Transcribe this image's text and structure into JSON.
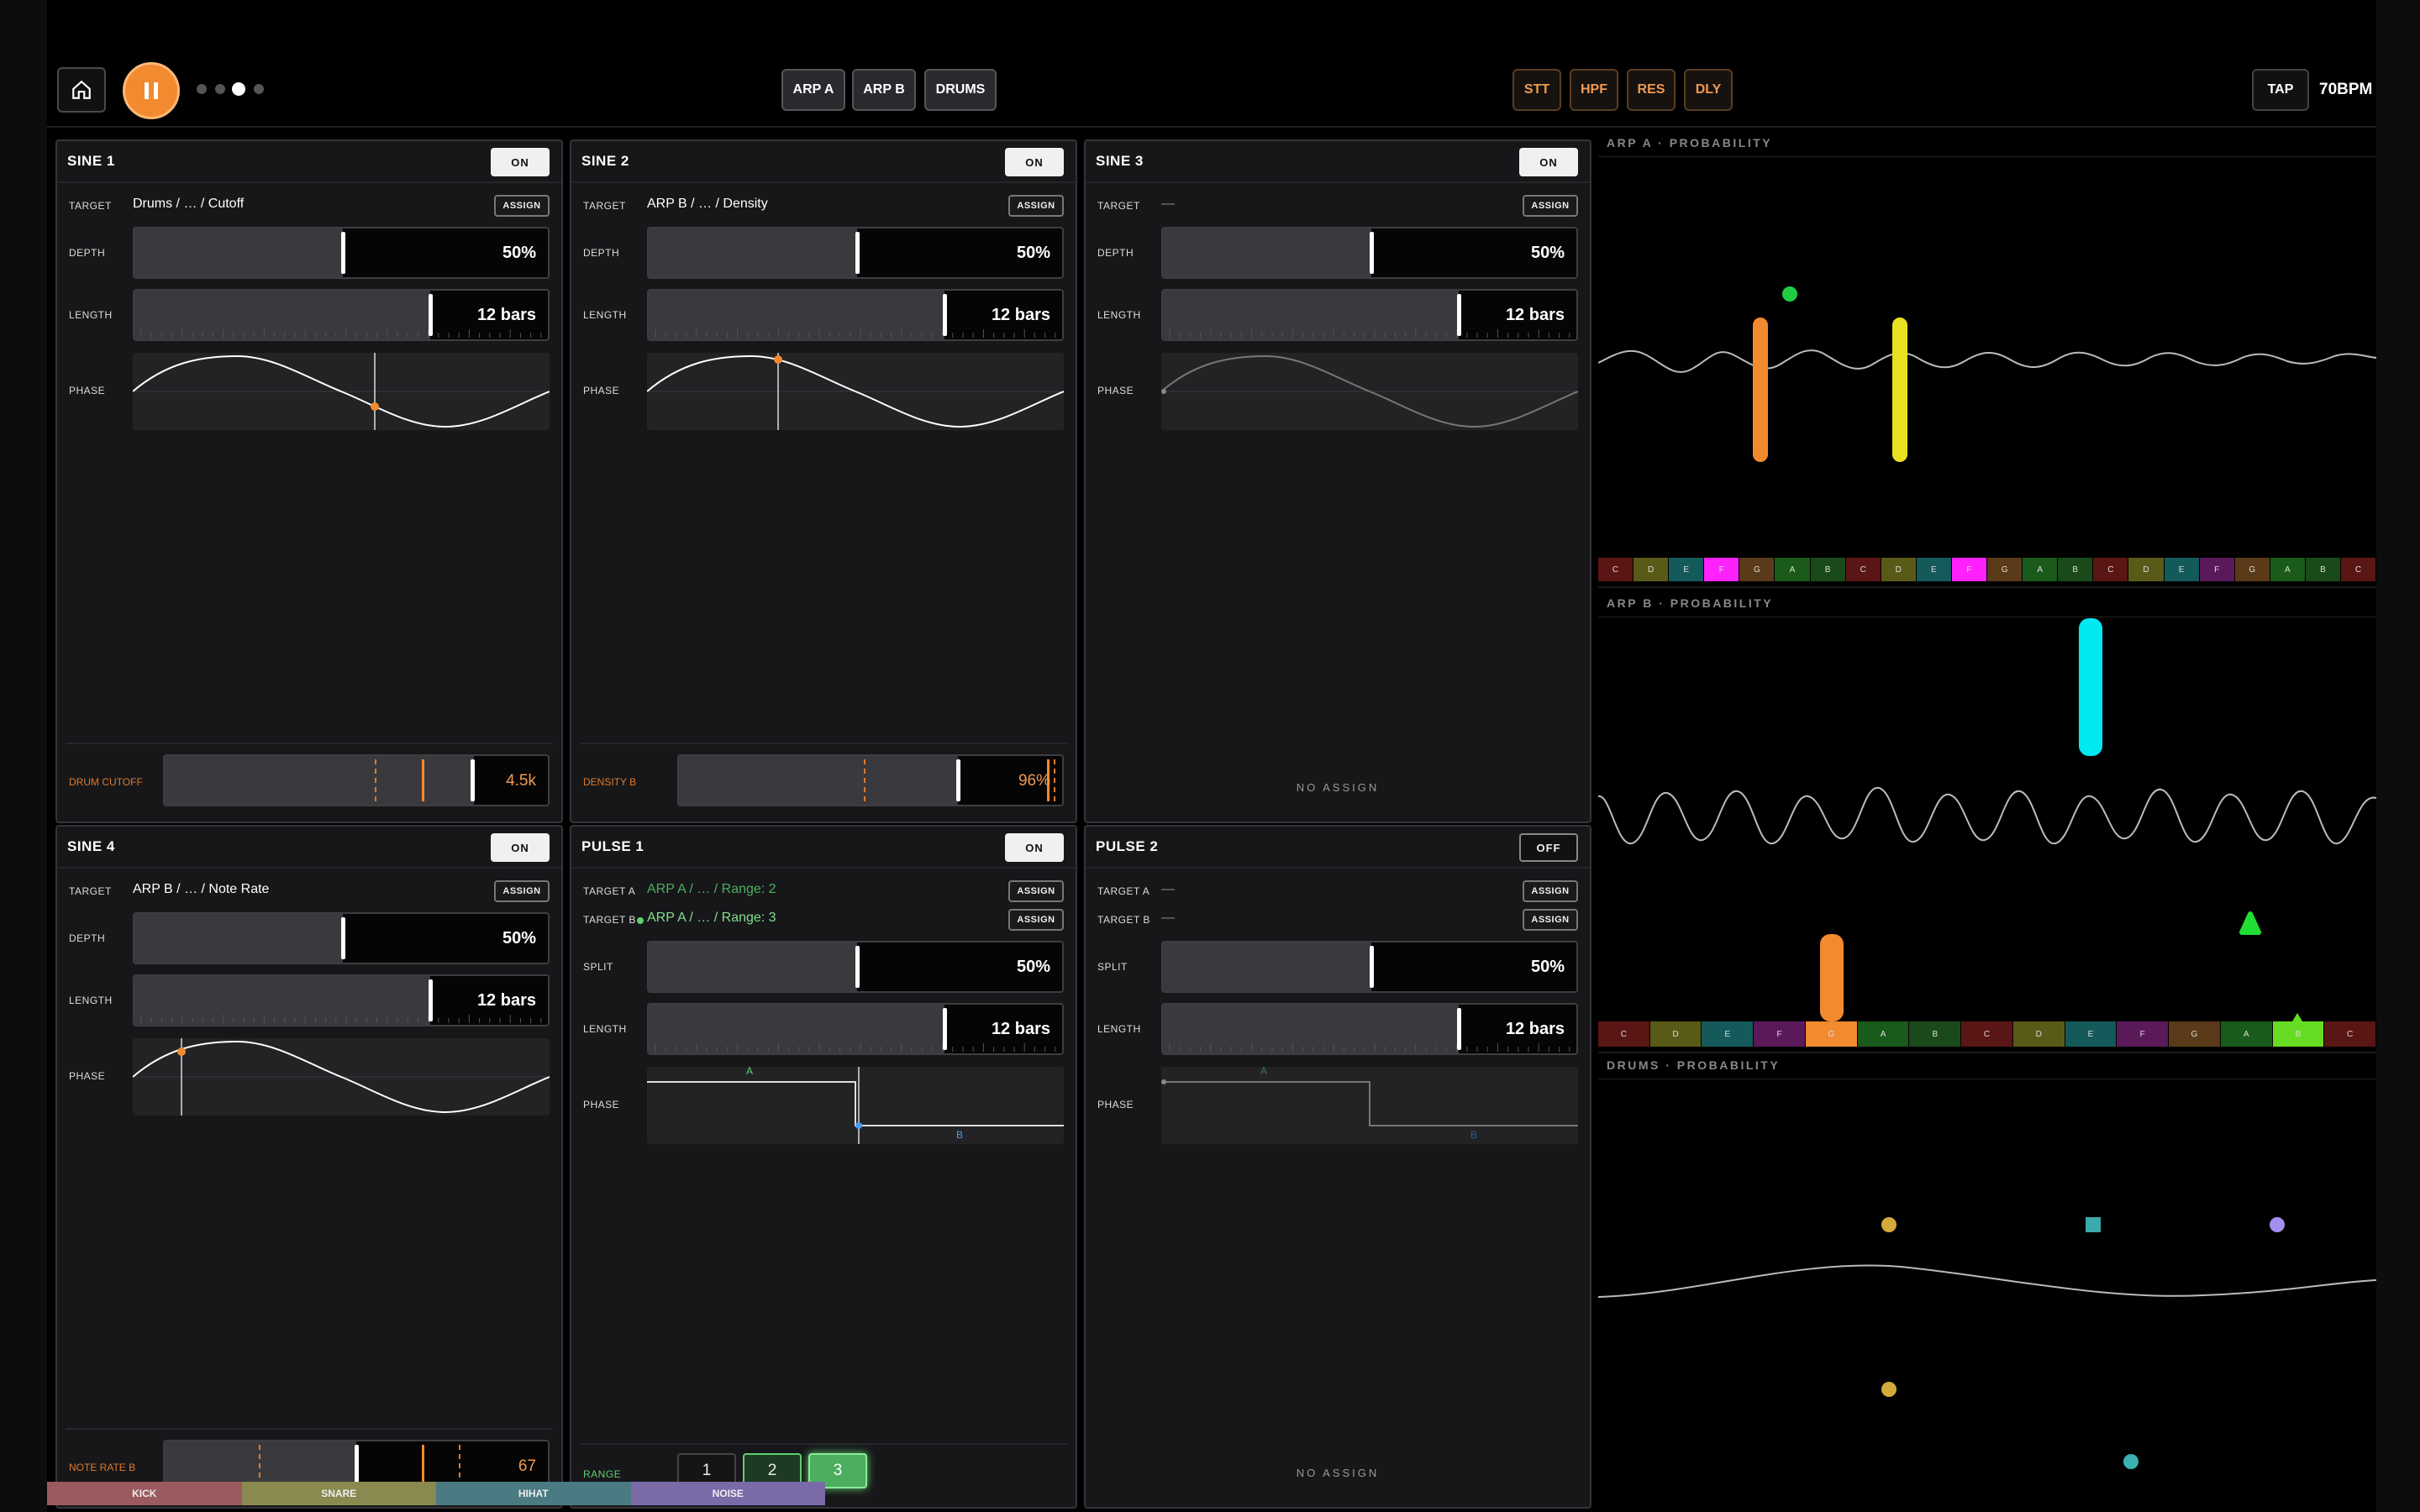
{
  "header": {
    "home_icon": "home-icon",
    "play_pause_icon": "pause-icon",
    "tracks": [
      "ARP A",
      "ARP B",
      "DRUMS"
    ],
    "fx": [
      "STT",
      "HPF",
      "RES",
      "DLY"
    ],
    "tap_label": "TAP",
    "bpm": "70BPM",
    "page_dots": 4,
    "active_dot": 3
  },
  "colors": {
    "accent": "#f28a30",
    "green": "#5fcf6e",
    "bg": "#000000",
    "panel": "#17171a"
  },
  "panels": [
    {
      "title": "SINE 1",
      "toggle": "ON",
      "target_label": "TARGET",
      "target": "Drums / … / Cutoff",
      "assign": "ASSIGN",
      "depth_label": "DEPTH",
      "depth_value": "50%",
      "depth": 0.5,
      "length_label": "LENGTH",
      "length_value": "12 bars",
      "length": 0.71,
      "phase_label": "PHASE",
      "phase": 0.58,
      "bottom_label": "DRUM CUTOFF",
      "bottom_value": "4.5k"
    },
    {
      "title": "SINE 2",
      "toggle": "ON",
      "target_label": "TARGET",
      "target": "ARP B / … / Density",
      "assign": "ASSIGN",
      "depth_label": "DEPTH",
      "depth_value": "50%",
      "depth": 0.5,
      "length_label": "LENGTH",
      "length_value": "12 bars",
      "length": 0.71,
      "phase_label": "PHASE",
      "phase": 0.31,
      "bottom_label": "DENSITY B",
      "bottom_value": "96%"
    },
    {
      "title": "SINE 3",
      "toggle": "ON",
      "target_label": "TARGET",
      "target": "—",
      "assign": "ASSIGN",
      "depth_label": "DEPTH",
      "depth_value": "50%",
      "depth": 0.5,
      "length_label": "LENGTH",
      "length_value": "12 bars",
      "length": 0.71,
      "phase_label": "PHASE",
      "phase": 0.0,
      "no_assign": "NO ASSIGN"
    },
    {
      "title": "SINE 4",
      "toggle": "ON",
      "target_label": "TARGET",
      "target": "ARP B / … / Note Rate",
      "assign": "ASSIGN",
      "depth_label": "DEPTH",
      "depth_value": "50%",
      "depth": 0.5,
      "length_label": "LENGTH",
      "length_value": "12 bars",
      "length": 0.71,
      "phase_label": "PHASE",
      "phase": 0.12,
      "bottom_label": "NOTE RATE B",
      "bottom_value": "67"
    },
    {
      "title": "PULSE 1",
      "toggle": "ON",
      "target_a_label": "TARGET A",
      "target_a": "ARP A / … / Range: 2",
      "target_b_label": "TARGET B",
      "target_b": "ARP A / … / Range: 3",
      "assign": "ASSIGN",
      "split_label": "SPLIT",
      "split_value": "50%",
      "split": 0.5,
      "length_label": "LENGTH",
      "length_value": "12 bars",
      "length": 0.71,
      "phase_label": "PHASE",
      "phase_a": "A",
      "phase_b": "B",
      "range_label": "RANGE",
      "range_options": [
        "1",
        "2",
        "3"
      ],
      "range_selected": "3"
    },
    {
      "title": "PULSE 2",
      "toggle": "OFF",
      "target_a_label": "TARGET A",
      "target_a": "—",
      "target_b_label": "TARGET B",
      "target_b": "—",
      "assign": "ASSIGN",
      "split_label": "SPLIT",
      "split_value": "50%",
      "split": 0.5,
      "length_label": "LENGTH",
      "length_value": "12 bars",
      "length": 0.71,
      "phase_label": "PHASE",
      "phase_a": "A",
      "phase_b": "B",
      "no_assign": "NO ASSIGN"
    }
  ],
  "viz": {
    "arp_a": {
      "title": "ARP A · PROBABILITY",
      "notes": [
        "C",
        "D",
        "E",
        "F",
        "G",
        "A",
        "B",
        "C",
        "D",
        "E",
        "F",
        "G",
        "A",
        "B",
        "C",
        "D",
        "E",
        "F",
        "G",
        "A",
        "B",
        "C"
      ],
      "note_colors": [
        "#5a1515",
        "#5a5a18",
        "#155a5a",
        "#ff22ff",
        "#5a3a18",
        "#1a5a1a",
        "#1a4a1a",
        "#5a1515",
        "#5a5a18",
        "#155a5a",
        "#ff22ff",
        "#5a3a18",
        "#1a5a1a",
        "#1a4a1a",
        "#5a1515",
        "#5a5a18",
        "#155a5a",
        "#5a1a5a",
        "#5a3a18",
        "#1a5a1a",
        "#1a4a1a",
        "#5a1515"
      ]
    },
    "arp_b": {
      "title": "ARP B · PROBABILITY",
      "notes": [
        "C",
        "D",
        "E",
        "F",
        "G",
        "A",
        "B",
        "C",
        "D",
        "E",
        "F",
        "G",
        "A",
        "B",
        "C"
      ],
      "note_colors": [
        "#5a1515",
        "#5a5a18",
        "#155a5a",
        "#5a1a5a",
        "#f28a30",
        "#1a5a1a",
        "#1a4a1a",
        "#5a1515",
        "#5a5a18",
        "#155a5a",
        "#5a1a5a",
        "#5a3a18",
        "#1a5a1a",
        "#66dd22",
        "#5a1515"
      ]
    },
    "drums": {
      "title": "DRUMS · PROBABILITY",
      "lanes": [
        "KICK",
        "SNARE",
        "HIHAT",
        "NOISE"
      ],
      "lane_colors": [
        "#9a5a5e",
        "#8a8a50",
        "#4a7a82",
        "#7a6aa8"
      ]
    }
  }
}
